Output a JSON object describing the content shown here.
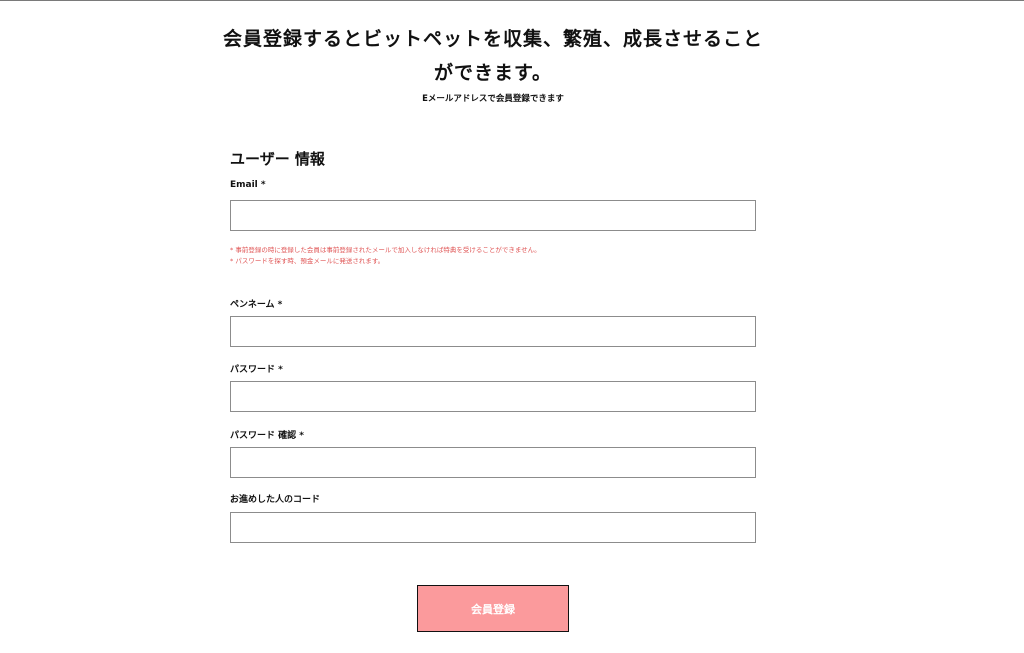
{
  "hero": {
    "title_line1": "会員登録するとビットペットを収集、繁殖、成長させること",
    "title_line2": "ができます。",
    "subtitle": "Eメールアドレスで会員登録できます"
  },
  "form": {
    "section_title": "ユーザー 情報",
    "fields": [
      {
        "label": "Email *",
        "value": "",
        "placeholder": ""
      },
      {
        "label": "ペンネーム *",
        "value": "",
        "placeholder": ""
      },
      {
        "label": "パスワード *",
        "value": "",
        "placeholder": ""
      },
      {
        "label": "パスワード 確認 *",
        "value": "",
        "placeholder": ""
      },
      {
        "label": "お進めした人のコード",
        "value": "",
        "placeholder": ""
      }
    ],
    "notes": [
      "* 事前登録の時に登録した会員は事前登録されたメールで加入しなければ特典を受けることができません。",
      "* パスワードを探す時、預金メールに発送されます。"
    ],
    "submit_label": "会員登録"
  },
  "colors": {
    "button_bg": "#fb9a9c",
    "note_text": "#e05757"
  }
}
